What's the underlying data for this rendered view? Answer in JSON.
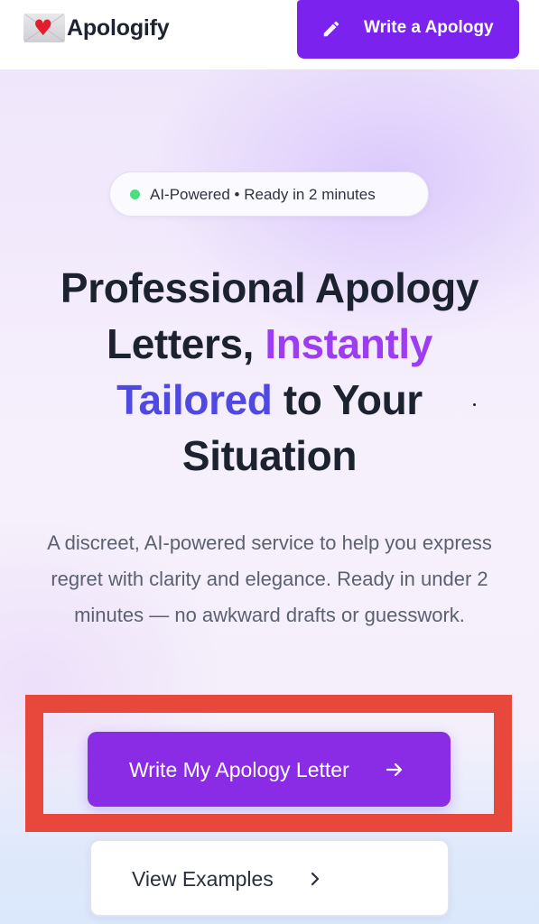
{
  "header": {
    "brand_name": "Apologify",
    "brand_icon": "envelope-heart-icon",
    "cta_label": "Write a Apology",
    "cta_icon": "pencil-icon"
  },
  "hero": {
    "badge_text": "AI-Powered • Ready in 2 minutes",
    "headline": {
      "line1": "Professional Apology",
      "line2_prefix": "Letters, ",
      "line2_highlight": "Instantly",
      "line3_highlight": "Tailored",
      "line3_suffix": " to Your",
      "line4": "Situation"
    },
    "subtitle": "A discreet, AI-powered service to help you express regret with clarity and elegance. Ready in under 2 minutes — no awkward drafts or guesswork.",
    "primary_cta": "Write My Apology Letter",
    "primary_cta_icon": "arrow-right-icon",
    "secondary_cta": "View Examples",
    "secondary_cta_icon": "chevron-right-icon"
  },
  "colors": {
    "brand_purple": "#7c22ee",
    "headline_purple": "#9d3cf0",
    "headline_indigo": "#4f48e2",
    "status_green": "#4ade80",
    "highlight_red": "#e8473b"
  }
}
